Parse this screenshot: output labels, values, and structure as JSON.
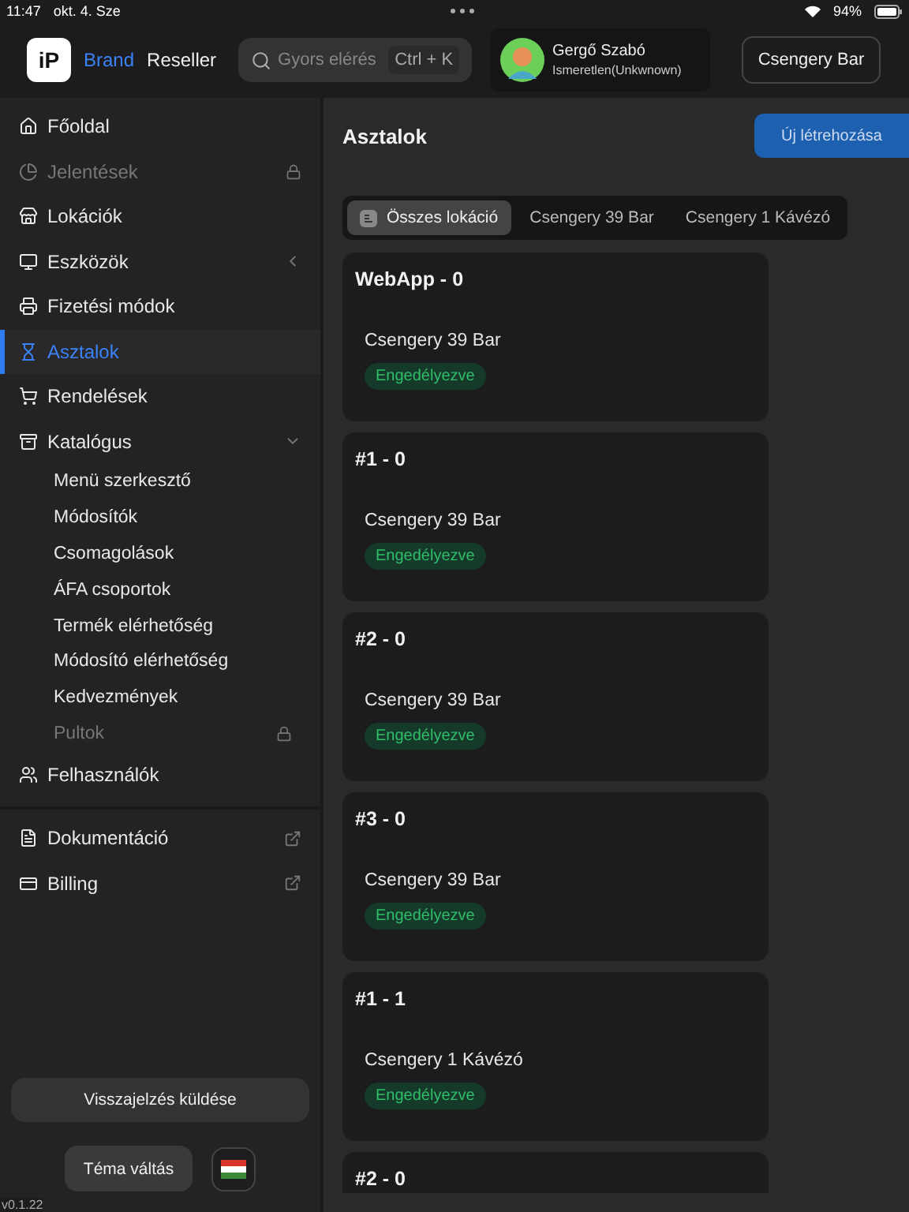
{
  "status_bar": {
    "time": "11:47",
    "date": "okt. 4. Sze",
    "battery": "94%"
  },
  "header": {
    "logo": "iP",
    "nav": [
      {
        "label": "Brand",
        "selected": true
      },
      {
        "label": "Reseller",
        "selected": false
      }
    ],
    "search": {
      "placeholder": "Gyors elérés",
      "shortcut": "Ctrl + K"
    },
    "user": {
      "name": "Gergő Szabó",
      "role": "Ismeretlen(Unkwnown)"
    },
    "location_button": "Csengery Bar"
  },
  "sidebar": {
    "items": [
      {
        "label": "Főoldal",
        "selected": false,
        "locked": false
      },
      {
        "label": "Jelentések",
        "selected": false,
        "locked": true
      },
      {
        "label": "Lokációk",
        "selected": false,
        "locked": false
      },
      {
        "label": "Eszközök",
        "selected": false,
        "locked": false,
        "expanded": false
      },
      {
        "label": "Fizetési módok",
        "selected": false,
        "locked": false
      },
      {
        "label": "Asztalok",
        "selected": true,
        "locked": false
      },
      {
        "label": "Rendelések",
        "selected": false,
        "locked": false
      },
      {
        "label": "Katalógus",
        "selected": false,
        "locked": false,
        "expanded": true,
        "children": [
          {
            "label": "Menü szerkesztő",
            "locked": false
          },
          {
            "label": "Módosítók",
            "locked": false
          },
          {
            "label": "Csomagolások",
            "locked": false
          },
          {
            "label": "ÁFA csoportok",
            "locked": false
          },
          {
            "label": "Termék elérhetőség",
            "locked": false
          },
          {
            "label": "Módosító elérhetőség",
            "locked": false
          },
          {
            "label": "Kedvezmények",
            "locked": false
          },
          {
            "label": "Pultok",
            "locked": true
          }
        ]
      },
      {
        "label": "Felhasználók",
        "selected": false,
        "locked": false
      }
    ],
    "links": [
      {
        "label": "Dokumentáció"
      },
      {
        "label": "Billing"
      }
    ],
    "feedback_button": "Visszajelzés küldése",
    "theme_button": "Téma váltás",
    "version": "v0.1.22"
  },
  "main": {
    "title": "Asztalok",
    "create_button": "Új létrehozása",
    "tabs": [
      {
        "label": "Összes lokáció",
        "selected": true
      },
      {
        "label": "Csengery 39 Bar",
        "selected": false
      },
      {
        "label": "Csengery 1 Kávézó",
        "selected": false
      }
    ],
    "cards": [
      {
        "title": "WebApp - 0",
        "location": "Csengery 39 Bar",
        "status": "Engedélyezve"
      },
      {
        "title": "#1 - 0",
        "location": "Csengery 39 Bar",
        "status": "Engedélyezve"
      },
      {
        "title": "#2 - 0",
        "location": "Csengery 39 Bar",
        "status": "Engedélyezve"
      },
      {
        "title": "#3 - 0",
        "location": "Csengery 39 Bar",
        "status": "Engedélyezve"
      },
      {
        "title": "#1 - 1",
        "location": "Csengery 1 Kávézó",
        "status": "Engedélyezve"
      },
      {
        "title": "#2 - 0"
      }
    ]
  }
}
